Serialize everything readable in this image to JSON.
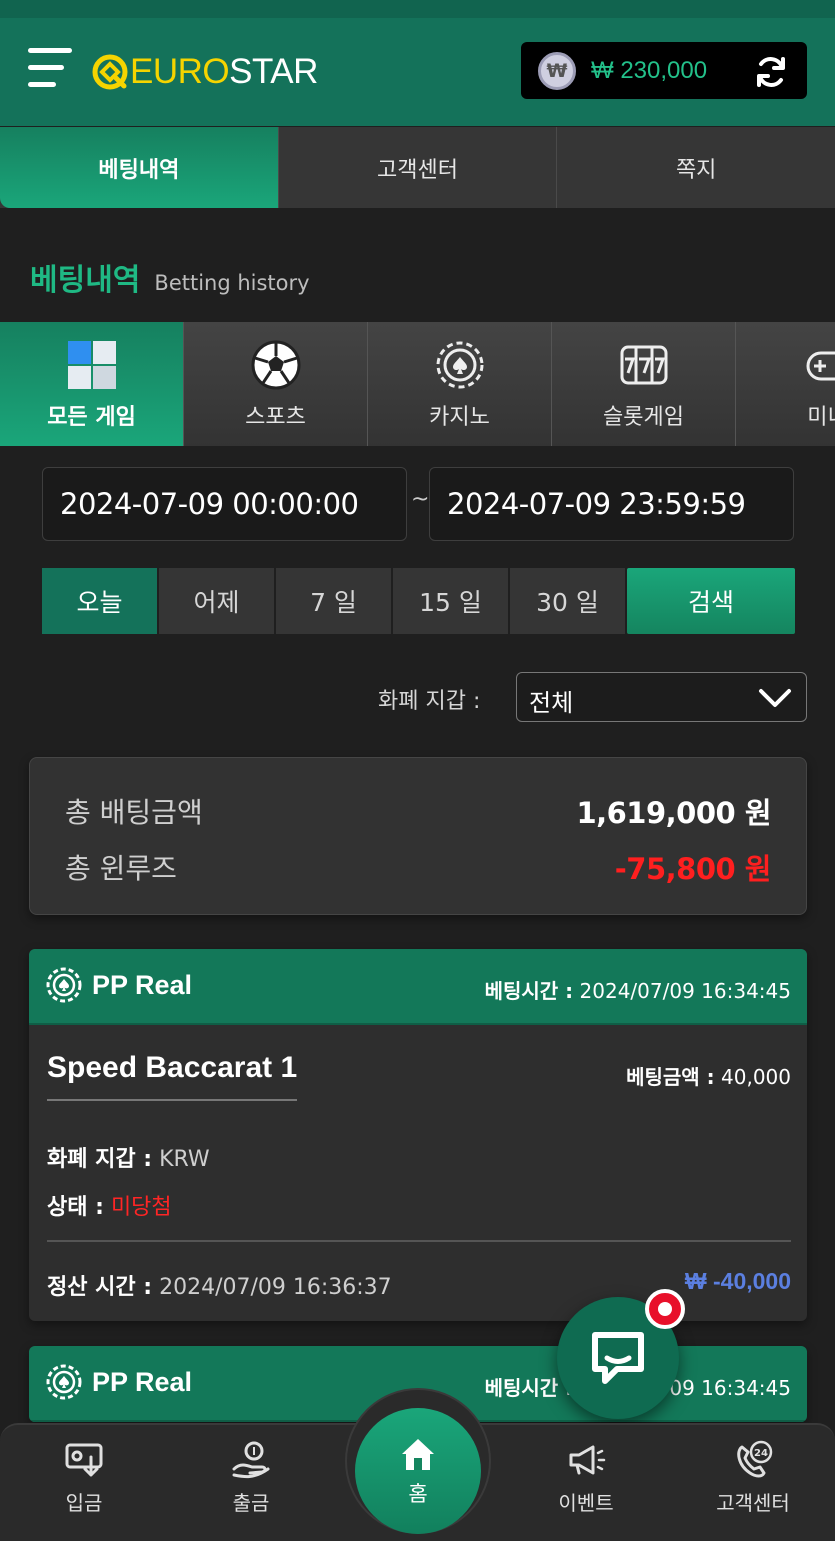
{
  "header": {
    "logo_euro": "EURO",
    "logo_star": "STAR",
    "coin_symbol": "₩",
    "balance": "₩ 230,000"
  },
  "tabs": [
    {
      "label": "베팅내역",
      "active": true
    },
    {
      "label": "고객센터",
      "active": false
    },
    {
      "label": "쪽지",
      "active": false
    }
  ],
  "section": {
    "title_ko": "베팅내역",
    "title_en": "Betting history"
  },
  "categories": [
    {
      "label": "모든 게임",
      "icon": "all-games-icon",
      "active": true
    },
    {
      "label": "스포츠",
      "icon": "soccer-ball-icon",
      "active": false
    },
    {
      "label": "카지노",
      "icon": "casino-chip-icon",
      "active": false
    },
    {
      "label": "슬롯게임",
      "icon": "slot-machine-icon",
      "active": false
    },
    {
      "label": "미니",
      "icon": "gamepad-icon",
      "active": false
    }
  ],
  "filter": {
    "date_from": "2024-07-09 00:00:00",
    "date_sep": "~",
    "date_to": "2024-07-09 23:59:59",
    "quick_ranges": [
      "오늘",
      "어제",
      "7 일",
      "15 일",
      "30 일"
    ],
    "search_label": "검색",
    "currency_label": "화폐 지갑 :",
    "currency_value": "전체"
  },
  "summary": {
    "total_bet_label": "총 배팅금액",
    "total_bet_value": "1,619,000 원",
    "total_winloss_label": "총 윈루즈",
    "total_winloss_value": "-75,800 원"
  },
  "bets": [
    {
      "provider": "PP Real",
      "time_label": "베팅시간 :",
      "time_value": "2024/07/09 16:34:45",
      "game": "Speed Baccarat 1",
      "amount_label": "베팅금액 :",
      "amount_value": "40,000",
      "currency_label": "화폐 지갑 :",
      "currency_value": "KRW",
      "status_label": "상태 :",
      "status_value": "미당첨",
      "settle_label": "정산 시간 :",
      "settle_value": "2024/07/09 16:36:37",
      "settle_amount": "₩ -40,000"
    },
    {
      "provider": "PP Real",
      "time_label": "베팅시간 :",
      "time_value": "2024/07/09 16:34:45"
    }
  ],
  "bottom_nav": {
    "deposit": "입금",
    "withdraw": "출금",
    "home": "홈",
    "event": "이벤트",
    "support": "고객센터",
    "support_badge": "24"
  },
  "colors": {
    "brand_green": "#14725a",
    "accent_green": "#1aa67a",
    "logo_yellow": "#f5d400",
    "negative_red": "#ff1f1f",
    "settle_blue": "#5b7fe0"
  }
}
